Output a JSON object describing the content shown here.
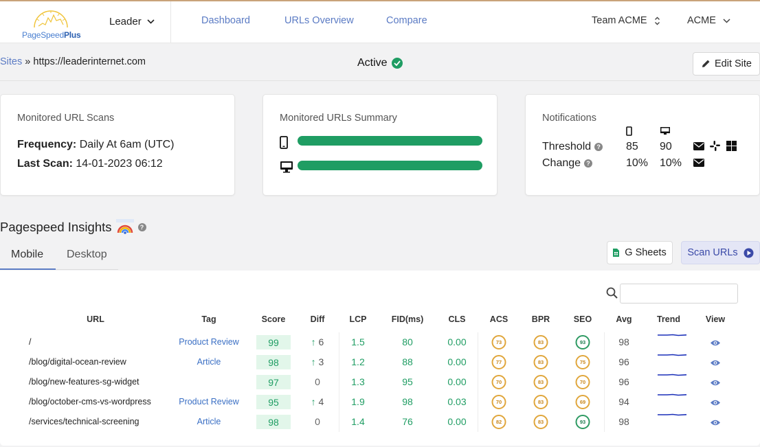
{
  "header": {
    "logo_text_a": "PageSpeed",
    "logo_text_b": "Plus",
    "site_switch": "Leader",
    "nav": [
      "Dashboard",
      "URLs Overview",
      "Compare"
    ],
    "team": "Team ACME",
    "account": "ACME"
  },
  "breadcrumb": {
    "root": "Sites",
    "sep": "»",
    "current": "https://leaderinternet.com"
  },
  "status": "Active",
  "edit_button": "Edit Site",
  "cards": {
    "scans": {
      "title": "Monitored URL Scans",
      "frequency_label": "Frequency:",
      "frequency": "Daily At 6am (UTC)",
      "last_label": "Last Scan:",
      "last": "14-01-2023 06:12"
    },
    "summary": {
      "title": "Monitored URLs Summary",
      "mobile_fraction": 1.0,
      "desktop_fraction": 1.0
    },
    "notifications": {
      "title": "Notifications",
      "threshold_label": "Threshold",
      "change_label": "Change",
      "threshold_mobile": "85",
      "threshold_desktop": "90",
      "change_mobile": "10%",
      "change_desktop": "10%"
    }
  },
  "insights": {
    "title": "Pagespeed Insights",
    "tabs": [
      "Mobile",
      "Desktop"
    ],
    "gsheets": "G Sheets",
    "scan": "Scan URLs",
    "search_placeholder": ""
  },
  "table": {
    "headers": [
      "URL",
      "Tag",
      "Score",
      "Diff",
      "LCP",
      "FID(ms)",
      "CLS",
      "ACS",
      "BPR",
      "SEO",
      "Avg",
      "Trend",
      "View"
    ],
    "rows": [
      {
        "url": "/",
        "tag": "Product Review",
        "score": "99",
        "diff": "6",
        "diff_up": true,
        "lcp": "1.5",
        "fid": "80",
        "cls": "0.00",
        "acs": "73",
        "bpr": "83",
        "seo": "93",
        "avg": "98"
      },
      {
        "url": "/blog/digital-ocean-review",
        "tag": "Article",
        "score": "98",
        "diff": "3",
        "diff_up": true,
        "lcp": "1.2",
        "fid": "88",
        "cls": "0.00",
        "acs": "77",
        "bpr": "83",
        "seo": "75",
        "avg": "96"
      },
      {
        "url": "/blog/new-features-sg-widget",
        "tag": "",
        "score": "97",
        "diff": "0",
        "diff_up": false,
        "lcp": "1.3",
        "fid": "95",
        "cls": "0.00",
        "acs": "70",
        "bpr": "83",
        "seo": "70",
        "avg": "96"
      },
      {
        "url": "/blog/october-cms-vs-wordpress",
        "tag": "Product Review",
        "score": "95",
        "diff": "4",
        "diff_up": true,
        "lcp": "1.9",
        "fid": "98",
        "cls": "0.03",
        "acs": "70",
        "bpr": "83",
        "seo": "69",
        "avg": "94"
      },
      {
        "url": "/services/technical-screening",
        "tag": "Article",
        "score": "98",
        "diff": "0",
        "diff_up": false,
        "lcp": "1.4",
        "fid": "76",
        "cls": "0.00",
        "acs": "82",
        "bpr": "83",
        "seo": "93",
        "avg": "98"
      }
    ]
  },
  "colors": {
    "accent": "#5b7bc4",
    "good": "#1f9d63",
    "warn": "#e0a63c"
  }
}
